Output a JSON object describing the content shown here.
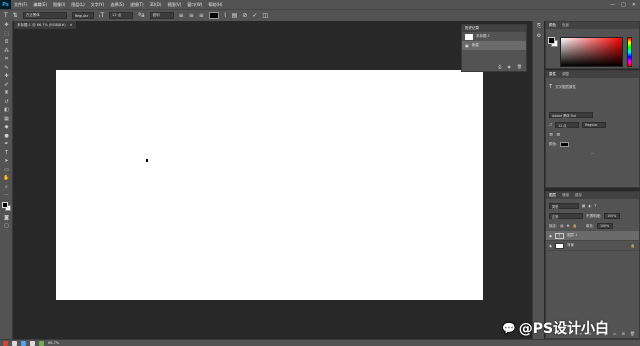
{
  "app": {
    "logo": "Ps"
  },
  "menu": [
    "文件(F)",
    "编辑(E)",
    "图像(I)",
    "图层(L)",
    "文字(Y)",
    "选择(S)",
    "滤镜(T)",
    "3D(D)",
    "视图(V)",
    "窗口(W)",
    "帮助(H)"
  ],
  "window_controls": [
    "—",
    "□",
    "✕"
  ],
  "options": {
    "font_family": "方正黑体",
    "font_style": "Regular",
    "font_size": "12 点",
    "antialias": "锐利",
    "color_hex": "#000000"
  },
  "doc_tab": {
    "title": "未标题-1 @ 66.7% (RGB/8#)",
    "close": "×"
  },
  "history": {
    "tabs": [
      "历史记录"
    ],
    "items": [
      "未标题-1",
      "新建"
    ]
  },
  "color_panel": {
    "tabs": [
      "颜色",
      "色板"
    ],
    "fg": "#000000",
    "bg": "#ffffff"
  },
  "properties": {
    "tabs": [
      "属性",
      "调整"
    ],
    "header": "文字图层属性",
    "font": "Adobe 黑体 Std",
    "size": "12 点",
    "style": "Regular",
    "color_label": "颜色:",
    "more": "..."
  },
  "layers": {
    "tabs": [
      "图层",
      "通道",
      "路径"
    ],
    "kind": "类型",
    "blend": "正常",
    "opacity_label": "不透明度:",
    "opacity": "100%",
    "lock_label": "锁定:",
    "fill_label": "填充:",
    "fill": "100%",
    "rows": [
      {
        "name": "图层 1",
        "type": "text",
        "selected": true
      },
      {
        "name": "背景",
        "type": "pixel",
        "selected": false
      }
    ]
  },
  "status": {
    "zoom": "66.7%"
  },
  "watermark": {
    "icon": "💬",
    "text": "@PS设计小白"
  }
}
